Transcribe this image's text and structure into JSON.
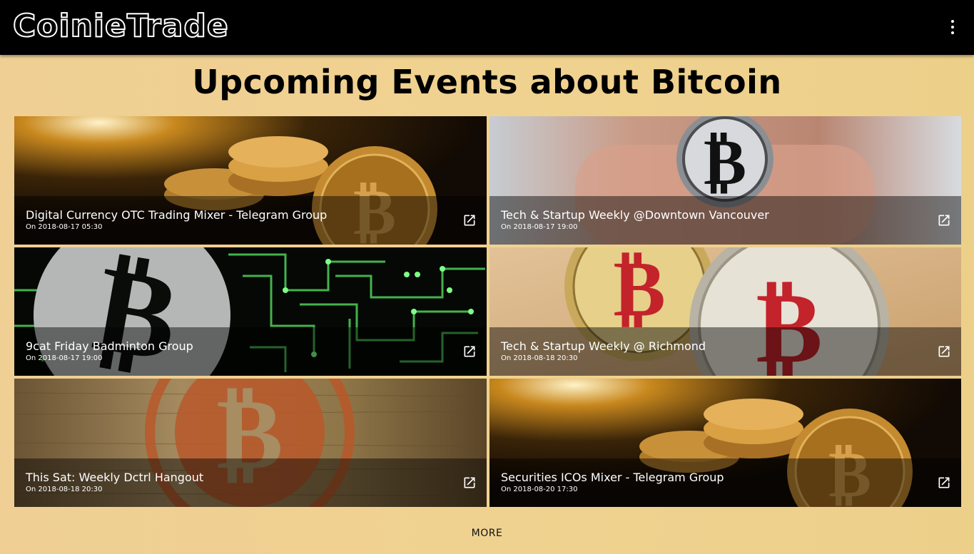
{
  "header": {
    "logo_text": "CoinieTrade",
    "menu_icon": "more-vert-icon"
  },
  "page": {
    "title": "Upcoming Events about Bitcoin",
    "more_label": "MORE"
  },
  "events": [
    {
      "title": "Digital Currency OTC Trading Mixer - Telegram Group",
      "date": "On 2018-08-17 05:30",
      "art": "gold-coins"
    },
    {
      "title": "Tech & Startup Weekly @Downtown Vancouver",
      "date": "On 2018-08-17 19:00",
      "art": "hand-coin"
    },
    {
      "title": "9cat Friday Badminton Group",
      "date": "On 2018-08-17 19:00",
      "art": "circuit"
    },
    {
      "title": "Tech & Startup Weekly @ Richmond",
      "date": "On 2018-08-18 20:30",
      "art": "red-coins"
    },
    {
      "title": "This Sat: Weekly Dctrl Hangout",
      "date": "On 2018-08-18 20:30",
      "art": "wood"
    },
    {
      "title": "Securities ICOs Mixer - Telegram Group",
      "date": "On 2018-08-20 17:30",
      "art": "gold-coins"
    }
  ],
  "colors": {
    "appbar": "#000000",
    "background": "#efcf94",
    "overlay": "rgba(0,0,0,0.45)"
  }
}
